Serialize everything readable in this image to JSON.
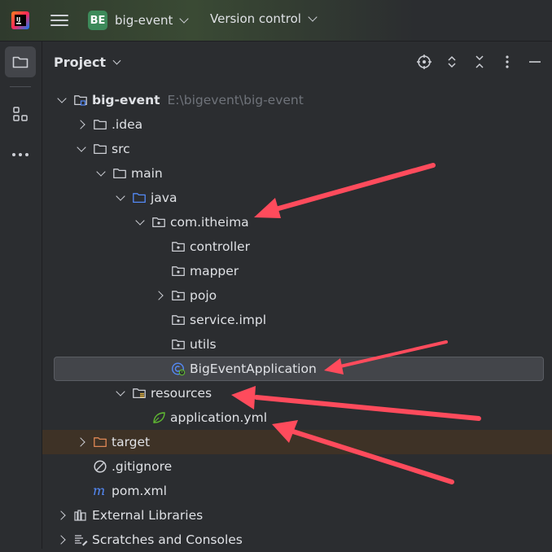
{
  "topbar": {
    "project_badge": "BE",
    "project_name": "big-event",
    "vcs_label": "Version control"
  },
  "panel": {
    "title": "Project"
  },
  "tree": [
    {
      "label": "big-event",
      "path": "E:\\bigevent\\big-event",
      "icon": "module-folder-icon",
      "arrow": "expanded",
      "indent": 0,
      "bold": true
    },
    {
      "label": ".idea",
      "icon": "folder-icon",
      "arrow": "collapsed",
      "indent": 1
    },
    {
      "label": "src",
      "icon": "folder-icon",
      "arrow": "expanded",
      "indent": 1
    },
    {
      "label": "main",
      "icon": "folder-icon",
      "arrow": "expanded",
      "indent": 2
    },
    {
      "label": "java",
      "icon": "source-folder-icon",
      "arrow": "expanded",
      "indent": 3
    },
    {
      "label": "com.itheima",
      "icon": "package-icon",
      "arrow": "expanded",
      "indent": 4
    },
    {
      "label": "controller",
      "icon": "package-icon",
      "arrow": "none",
      "indent": 5
    },
    {
      "label": "mapper",
      "icon": "package-icon",
      "arrow": "none",
      "indent": 5
    },
    {
      "label": "pojo",
      "icon": "package-icon",
      "arrow": "collapsed",
      "indent": 5
    },
    {
      "label": "service.impl",
      "icon": "package-icon",
      "arrow": "none",
      "indent": 5
    },
    {
      "label": "utils",
      "icon": "package-icon",
      "arrow": "none",
      "indent": 5
    },
    {
      "label": "BigEventApplication",
      "icon": "spring-boot-class-icon",
      "arrow": "none",
      "indent": 5,
      "selected": true
    },
    {
      "label": "resources",
      "icon": "resources-folder-icon",
      "arrow": "expanded",
      "indent": 3
    },
    {
      "label": "application.yml",
      "icon": "spring-yml-icon",
      "arrow": "none",
      "indent": 4
    },
    {
      "label": "target",
      "icon": "excluded-folder-icon",
      "arrow": "collapsed",
      "indent": 1,
      "highlighted": true
    },
    {
      "label": ".gitignore",
      "icon": "ignore-file-icon",
      "arrow": "none",
      "indent": 1
    },
    {
      "label": "pom.xml",
      "icon": "maven-icon",
      "arrow": "none",
      "indent": 1
    },
    {
      "label": "External Libraries",
      "icon": "libraries-icon",
      "arrow": "collapsed",
      "indent": 0
    },
    {
      "label": "Scratches and Consoles",
      "icon": "scratches-icon",
      "arrow": "collapsed",
      "indent": 0
    }
  ],
  "colors": {
    "accent_arrow": "#ff4b5c",
    "folder": "#ced0d6",
    "source_folder": "#548af7",
    "excluded_folder": "#e08855",
    "spring": "#5fb832"
  }
}
